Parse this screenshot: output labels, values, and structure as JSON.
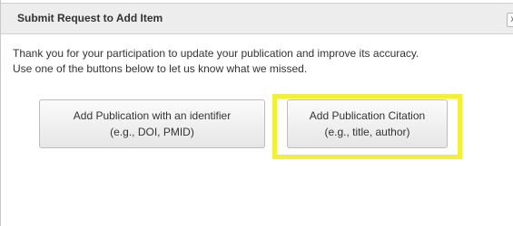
{
  "dialog": {
    "title": "Submit Request to Add Item",
    "close_glyph": "x",
    "message_line1": "Thank you for your participation to update your publication and improve its accuracy.",
    "message_line2": "Use one of the buttons below to let us know what we missed."
  },
  "buttons": {
    "identifier": {
      "line1": "Add Publication with an identifier",
      "line2": "(e.g., DOI, PMID)"
    },
    "citation": {
      "line1": "Add Publication Citation",
      "line2": "(e.g., title, author)"
    }
  },
  "colors": {
    "highlight": "#f3ef3a",
    "title_bar": "#ededed"
  }
}
